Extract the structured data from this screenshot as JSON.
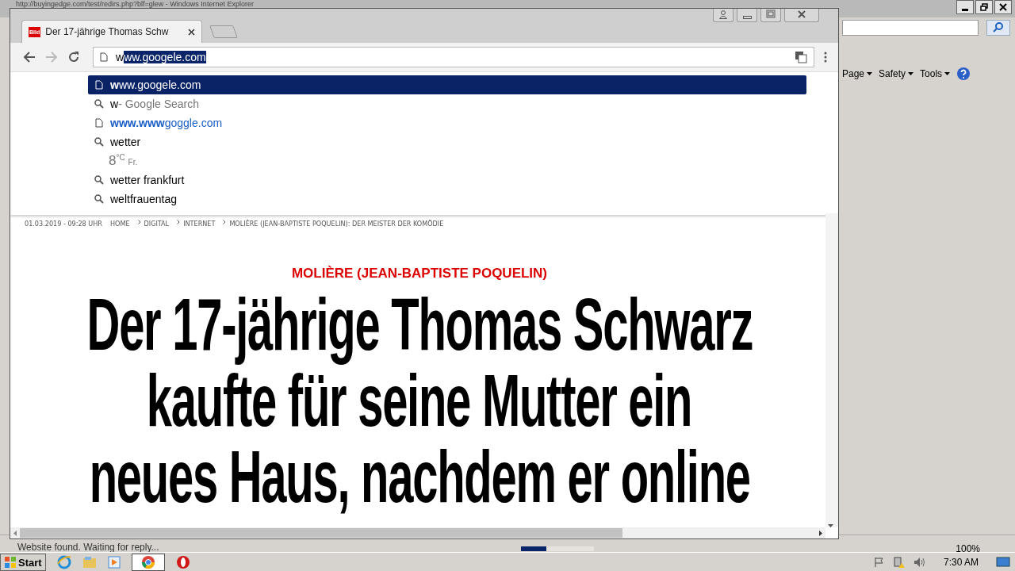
{
  "ie_window": {
    "title": "http://buyingedge.com/test/redirs.php?blf=glew - Windows Internet Explorer",
    "menu": [
      "Page",
      "Safety",
      "Tools"
    ],
    "status": "Website found. Waiting for reply...",
    "zoom": "100%",
    "progress": {
      "level": 0.35
    }
  },
  "chrome": {
    "tab": {
      "favicon": "Bild",
      "title": "Der 17-jährige Thomas Schw"
    },
    "address": {
      "typed": "w",
      "selected_text": "ww.googele.com"
    },
    "suggestions": [
      {
        "kind": "url",
        "text": "**w**ww.googele.com",
        "selected": true
      },
      {
        "kind": "search",
        "text": "w",
        "suffix": "- Google Search",
        "selected": false
      },
      {
        "kind": "link",
        "text": "**www.www**goggle.com",
        "selected": false
      },
      {
        "kind": "search",
        "text": "wetter",
        "selected": false
      },
      {
        "kind": "weather",
        "temp": "8",
        "unit": "°C",
        "day": "Fr.",
        "selected": false
      },
      {
        "kind": "search",
        "text": "wetter frankfurt",
        "selected": false
      },
      {
        "kind": "search",
        "text": "weltfrauentag",
        "selected": false
      }
    ]
  },
  "article": {
    "date": "01.03.2019 - 09:28 UHR",
    "breadcrumbs": [
      "HOME",
      "DIGITAL",
      "INTERNET",
      "MOLIÈRE (JEAN-BAPTISTE POQUELIN): DER MEISTER DER KOMÖDIE"
    ],
    "kicker": "MOLIÈRE (JEAN-BAPTISTE POQUELIN)",
    "headline_lines": [
      "Der 17-jährige Thomas Schwarz",
      "kaufte für seine Mutter ein",
      "neues Haus, nachdem er online"
    ]
  },
  "taskbar": {
    "start": "Start",
    "clock": "7:30 AM"
  }
}
